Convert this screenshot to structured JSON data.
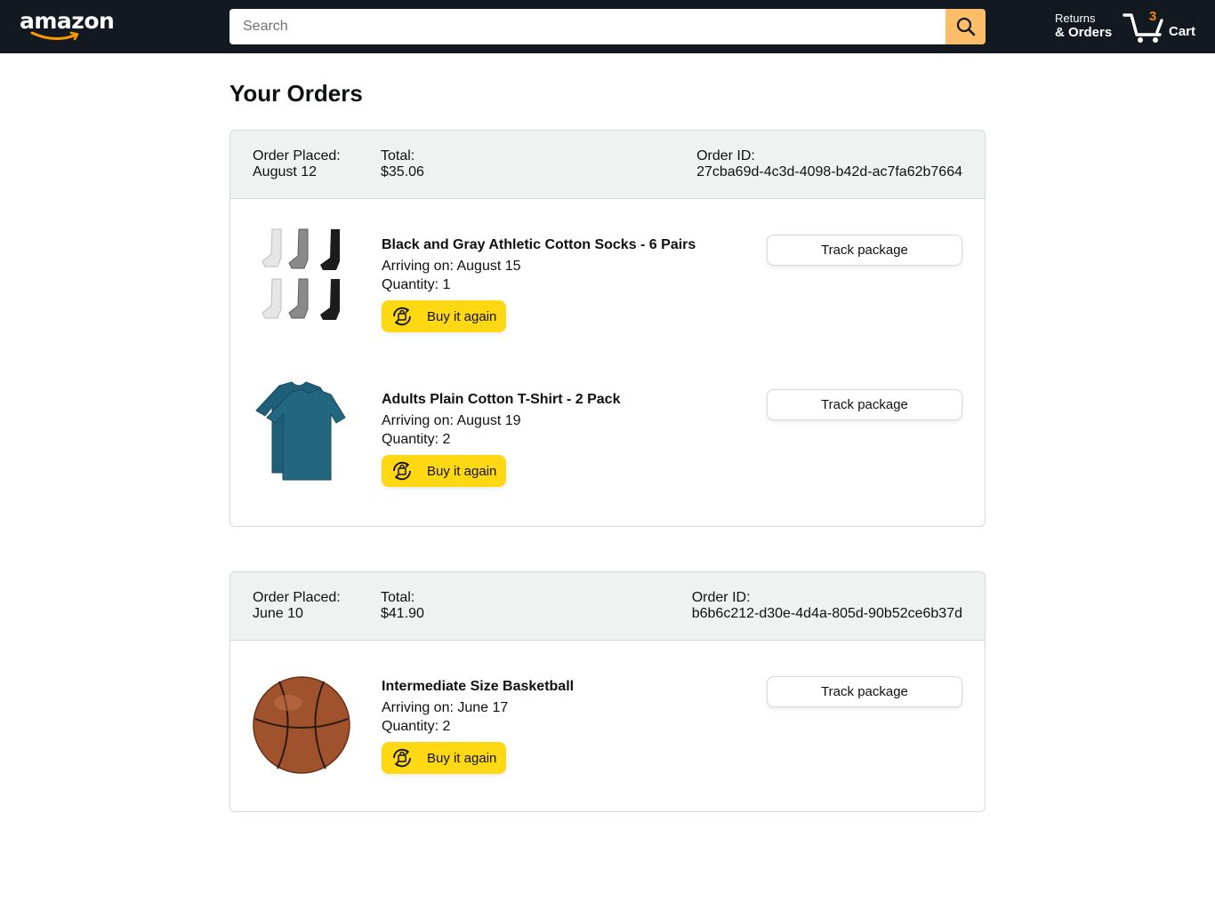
{
  "header": {
    "logo_text": "amazon",
    "search": {
      "placeholder": "Search",
      "value": "",
      "icon": "search-icon"
    },
    "returns": {
      "line1": "Returns",
      "line2": "& Orders"
    },
    "cart": {
      "count": "3",
      "label": "Cart",
      "icon": "cart-icon"
    }
  },
  "page": {
    "title": "Your Orders"
  },
  "orders": [
    {
      "placed_label": "Order Placed:",
      "placed_value": "August 12",
      "total_label": "Total:",
      "total_value": "$35.06",
      "id_label": "Order ID:",
      "id_value": "27cba69d-4c3d-4098-b42d-ac7fa62b7664",
      "items": [
        {
          "name": "Black and Gray Athletic Cotton Socks - 6 Pairs",
          "arrival": "Arriving on: August 15",
          "quantity": "Quantity: 1",
          "buy_again": "Buy it again",
          "track": "Track package",
          "image": "socks-image"
        },
        {
          "name": "Adults Plain Cotton T-Shirt - 2 Pack",
          "arrival": "Arriving on: August 19",
          "quantity": "Quantity: 2",
          "buy_again": "Buy it again",
          "track": "Track package",
          "image": "tshirt-image"
        }
      ]
    },
    {
      "placed_label": "Order Placed:",
      "placed_value": "June 10",
      "total_label": "Total:",
      "total_value": "$41.90",
      "id_label": "Order ID:",
      "id_value": "b6b6c212-d30e-4d4a-805d-90b52ce6b37d",
      "items": [
        {
          "name": "Intermediate Size Basketball",
          "arrival": "Arriving on: June 17",
          "quantity": "Quantity: 2",
          "buy_again": "Buy it again",
          "track": "Track package",
          "image": "basketball-image"
        }
      ]
    }
  ],
  "colors": {
    "header_bg": "#131921",
    "search_button": "#febd69",
    "cart_count": "#f08804",
    "buy_again": "#ffd814",
    "order_header_bg": "#f0f2f2",
    "border": "#d5d9d9"
  }
}
